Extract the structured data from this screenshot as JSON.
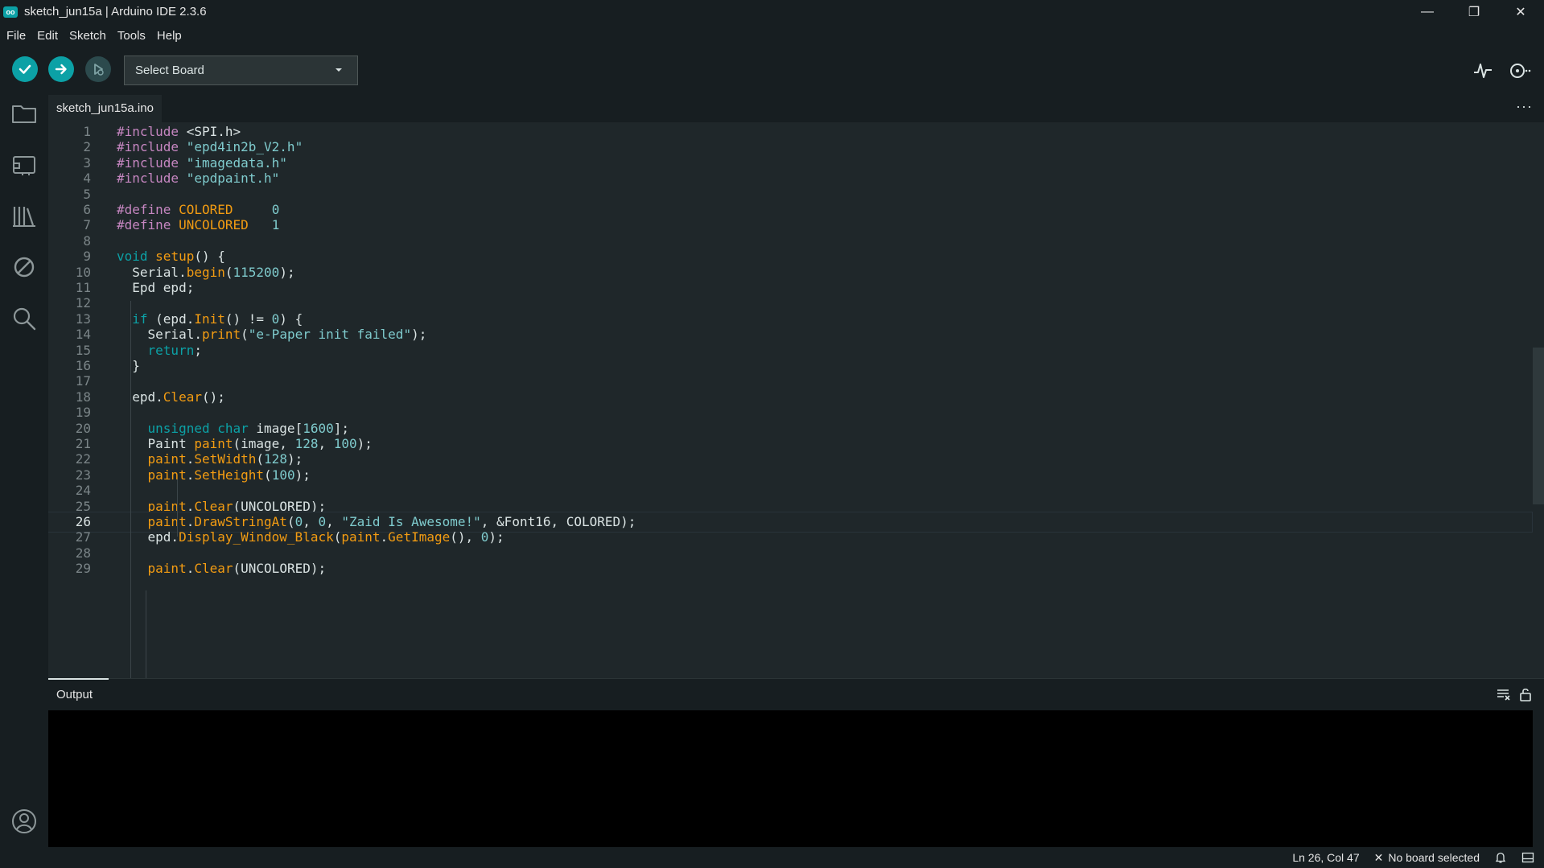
{
  "window": {
    "title": "sketch_jun15a | Arduino IDE 2.3.6",
    "logo_text": "oo",
    "controls": {
      "minimize": "—",
      "restore": "❐",
      "close": "✕"
    }
  },
  "menu": [
    "File",
    "Edit",
    "Sketch",
    "Tools",
    "Help"
  ],
  "toolbar": {
    "verify_icon": "check-icon",
    "upload_icon": "arrow-right-icon",
    "debug_icon": "debug-icon",
    "board_select": "Select Board",
    "serial_plotter_icon": "plotter-icon",
    "serial_monitor_icon": "serial-monitor-icon"
  },
  "activity": [
    "folder-icon",
    "board-icon",
    "library-icon",
    "debug-icon",
    "search-icon",
    "account-icon"
  ],
  "tab": {
    "label": "sketch_jun15a.ino",
    "more": "···"
  },
  "editor": {
    "active_line": 26,
    "lines": [
      {
        "n": "1",
        "text": "#include <SPI.h>"
      },
      {
        "n": "2",
        "text": "#include \"epd4in2b_V2.h\""
      },
      {
        "n": "3",
        "text": "#include \"imagedata.h\""
      },
      {
        "n": "4",
        "text": "#include \"epdpaint.h\""
      },
      {
        "n": "5",
        "text": ""
      },
      {
        "n": "6",
        "text": "#define COLORED     0"
      },
      {
        "n": "7",
        "text": "#define UNCOLORED   1"
      },
      {
        "n": "8",
        "text": ""
      },
      {
        "n": "9",
        "text": "void setup() {"
      },
      {
        "n": "10",
        "text": "  Serial.begin(115200);"
      },
      {
        "n": "11",
        "text": "  Epd epd;"
      },
      {
        "n": "12",
        "text": ""
      },
      {
        "n": "13",
        "text": "  if (epd.Init() != 0) {"
      },
      {
        "n": "14",
        "text": "    Serial.print(\"e-Paper init failed\");"
      },
      {
        "n": "15",
        "text": "    return;"
      },
      {
        "n": "16",
        "text": "  }"
      },
      {
        "n": "17",
        "text": ""
      },
      {
        "n": "18",
        "text": "  epd.Clear();"
      },
      {
        "n": "19",
        "text": ""
      },
      {
        "n": "20",
        "text": "    unsigned char image[1600];"
      },
      {
        "n": "21",
        "text": "    Paint paint(image, 128, 100);"
      },
      {
        "n": "22",
        "text": "    paint.SetWidth(128);"
      },
      {
        "n": "23",
        "text": "    paint.SetHeight(100);"
      },
      {
        "n": "24",
        "text": ""
      },
      {
        "n": "25",
        "text": "    paint.Clear(UNCOLORED);"
      },
      {
        "n": "26",
        "text": "    paint.DrawStringAt(0, 0, \"Zaid Is Awesome!\", &Font16, COLORED);"
      },
      {
        "n": "27",
        "text": "    epd.Display_Window_Black(paint.GetImage(), 0);"
      },
      {
        "n": "28",
        "text": ""
      },
      {
        "n": "29",
        "text": "    paint.Clear(UNCOLORED);"
      }
    ]
  },
  "panel": {
    "title": "Output",
    "clear_icon": "clear-output-icon",
    "lock_icon": "lock-icon"
  },
  "status": {
    "position": "Ln 26, Col 47",
    "board": "No board selected",
    "board_icon": "close-icon",
    "bell_icon": "bell-icon",
    "layout_icon": "panel-layout-icon"
  },
  "colors": {
    "accent": "#0ca1a6",
    "background": "#171e21",
    "editor": "#1f272a",
    "keyword": "#0ca1a6",
    "function": "#f39c12",
    "string": "#7fcbcd",
    "preprocessor": "#c586c0"
  }
}
